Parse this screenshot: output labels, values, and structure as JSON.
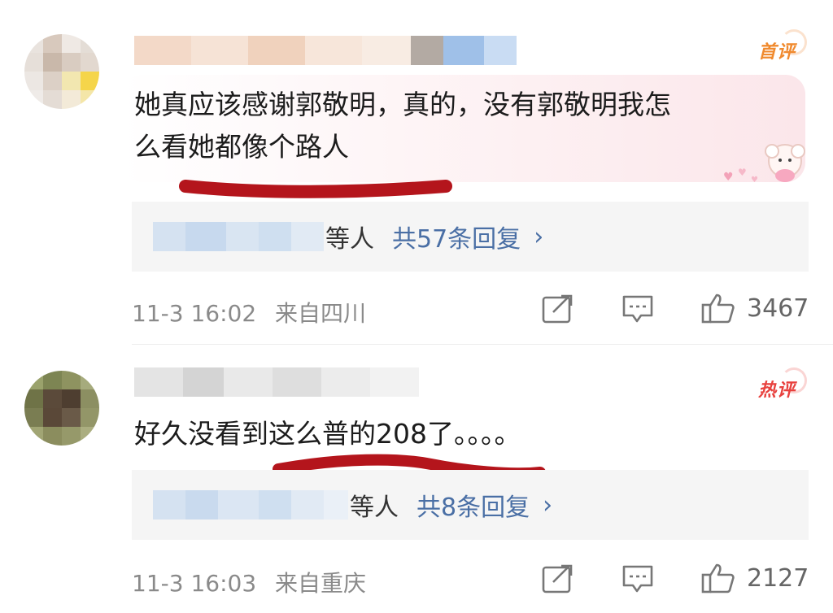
{
  "comments": [
    {
      "badge": "首评",
      "text": "她真应该感谢郭敬明，真的，没有郭敬明我怎\n么看她都像个路人",
      "reply_suffix": "等人",
      "reply_count": "共57条回复",
      "reply_arrow": "›",
      "time": "11-3 16:02",
      "location": "来自四川",
      "likes": "3467"
    },
    {
      "badge": "热评",
      "text": "好久没看到这么普的208了。。。。",
      "reply_suffix": "等人",
      "reply_count": "共8条回复",
      "reply_arrow": "›",
      "time": "11-3 16:03",
      "location": "来自重庆",
      "likes": "2127"
    }
  ],
  "icons": {
    "share": "share-icon",
    "comment": "comment-icon",
    "like": "thumbs-up-icon"
  },
  "colors": {
    "badge_first": "#f08a2e",
    "badge_hot": "#e8413e",
    "reply_link": "#4a6fa5",
    "meta_gray": "#8a8a8a",
    "annotation_red": "#b4151c"
  }
}
